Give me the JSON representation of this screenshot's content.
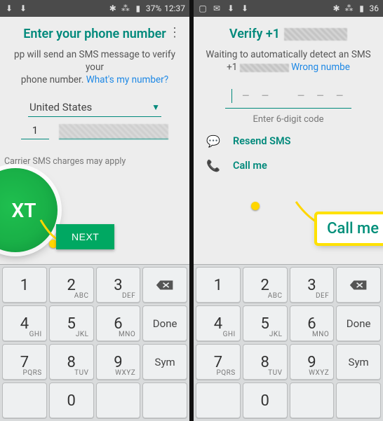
{
  "left": {
    "status": {
      "time": "12:37",
      "battery": "37%"
    },
    "title": "Enter your phone number",
    "sms_text_1": "pp will send an SMS message to verify your",
    "sms_text_2": "phone number.",
    "whats_my_number": "What's my number?",
    "country": "United States",
    "country_code": "1",
    "carrier_note": "Carrier SMS charges may apply",
    "next": "NEXT",
    "bubble_text": "XT"
  },
  "right": {
    "status": {
      "time": "",
      "battery": "36"
    },
    "verify_prefix": "Verify +1",
    "waiting_1": "Waiting to automatically detect an SMS",
    "waiting_2_prefix": "+1",
    "wrong_number": "Wrong numbe",
    "code_label": "Enter 6-digit code",
    "resend": "Resend SMS",
    "call_me": "Call me",
    "callme_highlight": "Call me"
  },
  "keypad": {
    "k1": "1",
    "k2": "2",
    "k2s": "ABC",
    "k3": "3",
    "k3s": "DEF",
    "k4": "4",
    "k4s": "GHI",
    "k5": "5",
    "k5s": "JKL",
    "k6": "6",
    "k6s": "MNO",
    "done": "Done",
    "k7": "7",
    "k7s": "PQRS",
    "k8": "8",
    "k8s": "TUV",
    "k9": "9",
    "k9s": "WXYZ",
    "sym": "Sym",
    "k0": "0"
  }
}
